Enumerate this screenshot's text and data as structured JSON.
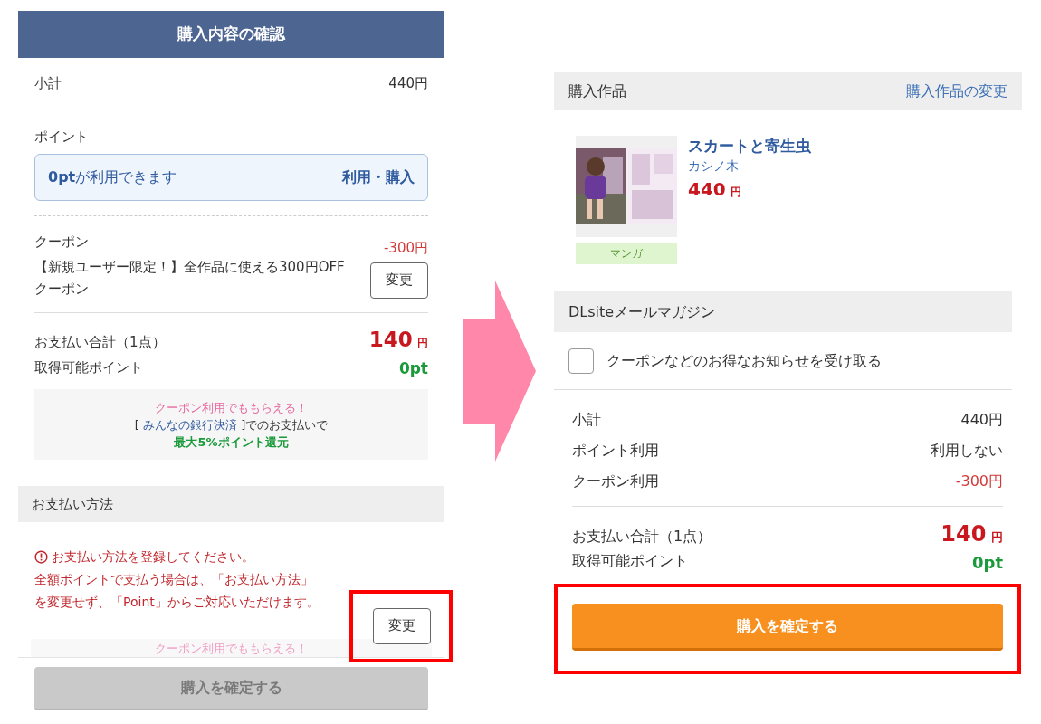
{
  "left_screen": {
    "header": "購入内容の確認",
    "subtotal": {
      "label": "小計",
      "value": "440円"
    },
    "points": {
      "label": "ポイント",
      "available": "**0pt**が利用できます",
      "action": "利用・購入"
    },
    "coupon": {
      "label": "クーポン",
      "amount": "-300円",
      "description": "【新規ユーザー限定！】全作品に使える300円OFFクーポン",
      "button": "変更"
    },
    "total": {
      "label": "お支払い合計（1点）",
      "value": "140",
      "unit": "円"
    },
    "earn": {
      "label": "取得可能ポイント",
      "value": "0pt"
    },
    "promo": {
      "headline": "クーポン利用でももらえる！",
      "prefix": "[ ",
      "link": "みんなの銀行決済",
      "suffix": " ]でのお支払いで",
      "highlight": "最大5%ポイント還元"
    },
    "payment": {
      "header": "お支払い方法",
      "warning_lines": [
        "お支払い方法を登録してください。",
        "全額ポイントで支払う場合は、「お支払い方法」",
        "を変更せず、「Point」からご対応いただけます。"
      ],
      "button": "変更"
    },
    "faded_promo": "クーポン利用でももらえる！",
    "confirm_button": {
      "label": "購入を確定する",
      "disabled": true
    }
  },
  "right_screen": {
    "section_header": "購入作品",
    "change_link": "購入作品の変更",
    "product": {
      "kind": "picture",
      "title": "スカートと寄生虫",
      "author": "カシノ木",
      "price": "440",
      "unit": "円",
      "category": "マンガ"
    },
    "mail_header": "DLsiteメールマガジン",
    "newsletter": {
      "label": "クーポンなどのお得なお知らせを受け取る",
      "checked": false
    },
    "summary": [
      {
        "label": "小計",
        "value": "440円",
        "kind": "plain"
      },
      {
        "label": "ポイント利用",
        "value": "利用しない",
        "kind": "plain"
      },
      {
        "label": "クーポン利用",
        "value": "-300円",
        "kind": "discount"
      }
    ],
    "total": {
      "label": "お支払い合計（1点）",
      "value": "140",
      "unit": "円"
    },
    "earn": {
      "label": "取得可能ポイント",
      "value": "0pt"
    },
    "confirm_button": {
      "label": "購入を確定する",
      "disabled": false
    }
  }
}
